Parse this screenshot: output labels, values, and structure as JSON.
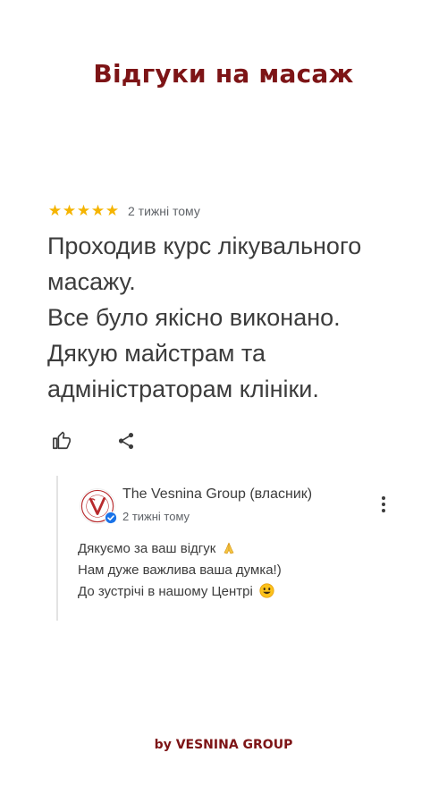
{
  "header": {
    "title": "Відгуки на масаж"
  },
  "review": {
    "rating": 5,
    "rating_max": 5,
    "star_glyph": "★",
    "star_color": "#f5b400",
    "time": "2 тижні тому",
    "text_lines": [
      "Проходив курс лікувального",
      "масажу.",
      "Все було якісно виконано.",
      "Дякую майстрам та",
      "адміністраторам клініки."
    ],
    "actions": {
      "like_icon": "thumbs-up-icon",
      "share_icon": "share-icon"
    }
  },
  "owner_reply": {
    "name": "The Vesnina Group (власник)",
    "time": "2 тижні тому",
    "avatar_icon": "vesnina-logo",
    "verified_icon": "verified-check-icon",
    "menu_icon": "more-vert-icon",
    "lines": [
      "Дякуємо за ваш відгук",
      "Нам дуже важлива ваша думка!)",
      "До зустрічі в нашому Центрі"
    ],
    "line1_emoji": "folded-hands-emoji",
    "line3_emoji": "smiling-face-emoji"
  },
  "footer": {
    "text": "by VESNINA GROUP"
  },
  "colors": {
    "brand": "#7d1416",
    "text": "#3c3c3c",
    "muted": "#5f6368",
    "star": "#f5b400",
    "verified": "#1a73e8"
  }
}
